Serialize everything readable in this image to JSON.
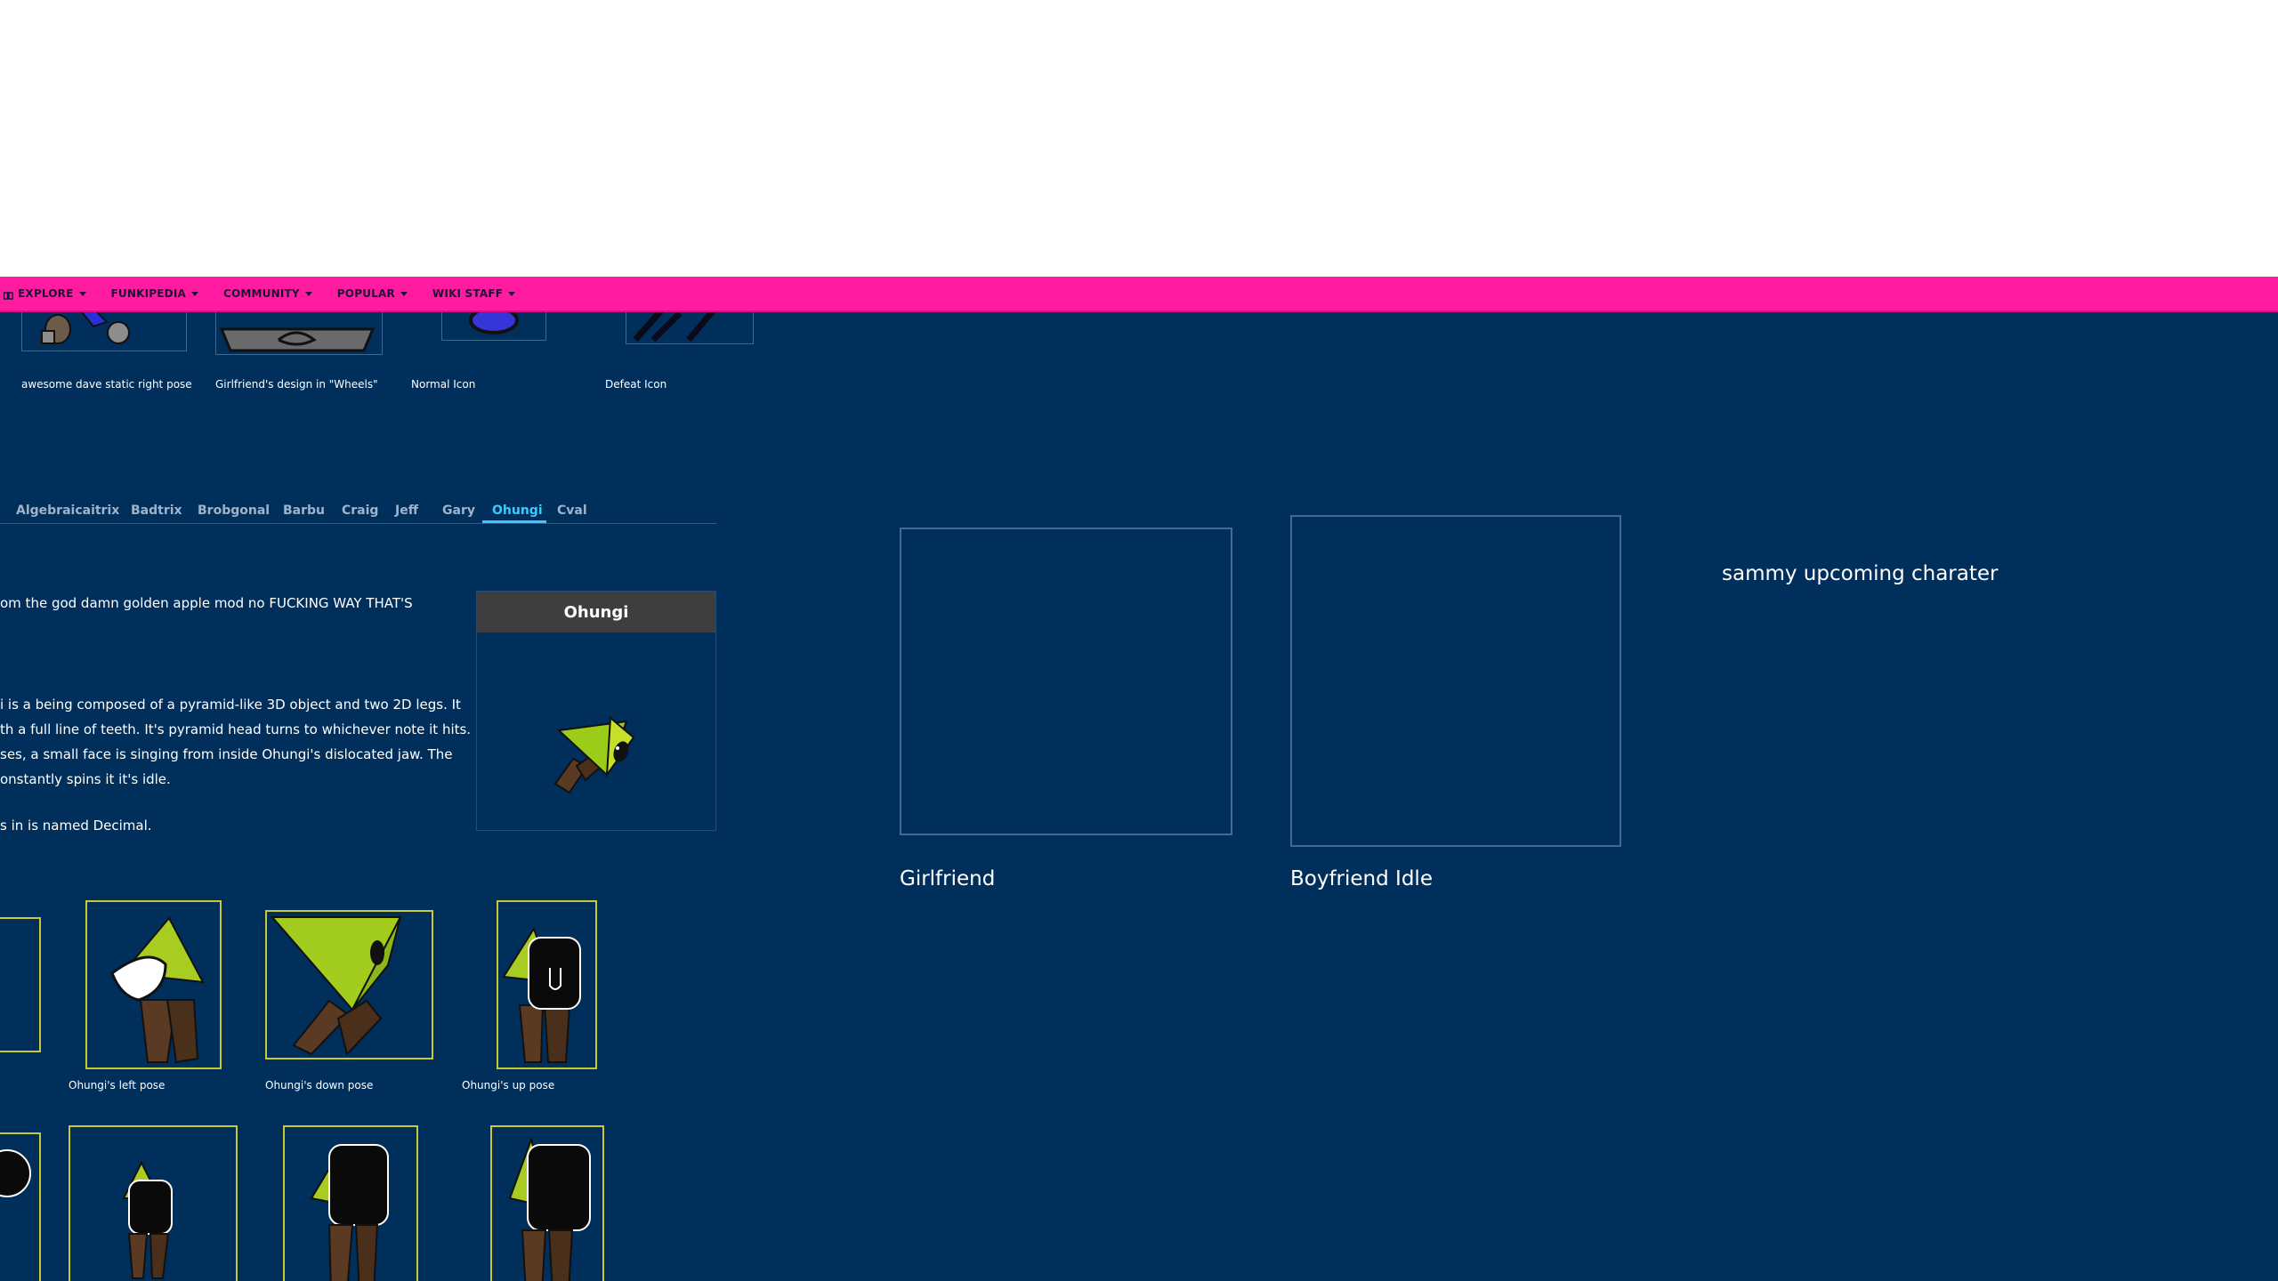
{
  "nav": {
    "items": [
      {
        "label": "EXPLORE",
        "icon": "explore-icon"
      },
      {
        "label": "FUNKIPEDIA"
      },
      {
        "label": "COMMUNITY"
      },
      {
        "label": "POPULAR"
      },
      {
        "label": "WIKI STAFF"
      }
    ]
  },
  "gallery_top": {
    "captions": [
      "awesome dave static right pose",
      "Girlfriend's design in \"Wheels\"",
      "Normal Icon",
      "Defeat Icon"
    ]
  },
  "tabs": {
    "items": [
      "Algebraicaitrix",
      "Badtrix",
      "Brobgonal",
      "Barbu",
      "Craig",
      "Jeff",
      "Gary",
      "Ohungi",
      "Cval"
    ],
    "active": "Ohungi"
  },
  "article": {
    "line1": "om the god damn golden apple mod no FUCKING WAY THAT'S",
    "desc_lines": [
      "i is a being composed of a pyramid-like 3D object and two 2D legs. It",
      "th a full line of teeth. It's pyramid head turns to whichever note it hits.",
      "ses, a small face is singing from inside Ohungi's dislocated jaw. The",
      "onstantly spins it it's idle."
    ],
    "last_line": "s in is named Decimal."
  },
  "infobox": {
    "title": "Ohungi"
  },
  "gallery_poses": {
    "captions": [
      "Ohungi's left pose",
      "Ohungi's down pose",
      "Ohungi's up pose"
    ]
  },
  "right_panel": {
    "girlfriend_label": "Girlfriend",
    "boyfriend_label": "Boyfriend Idle",
    "upcoming_text": "sammy upcoming charater"
  },
  "colors": {
    "navbar": "#ff1ca0",
    "background": "#002f5b",
    "active_tab": "#3ec8ff",
    "frame_border": "#c9c933"
  }
}
